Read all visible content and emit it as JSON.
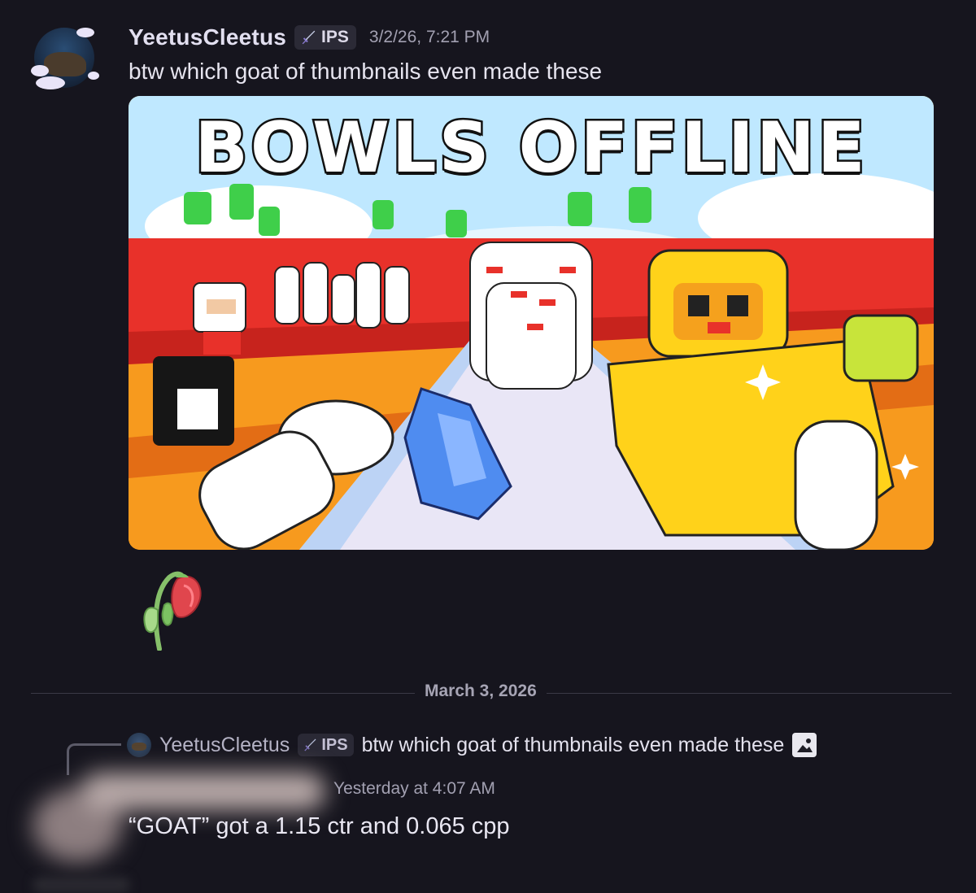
{
  "message1": {
    "author": "YeetusCleetus",
    "tag": "IPS",
    "tag_icon": "sword-icon",
    "timestamp": "3/2/26, 7:21 PM",
    "text": "btw which goat of thumbnails even made these",
    "attachment": {
      "type": "image",
      "overlay_text": "BOWLS OFFLINE"
    },
    "reaction": {
      "emoji": "wilted-flower-icon"
    }
  },
  "date_divider": {
    "label": "March 3, 2026"
  },
  "message2": {
    "reply_to": {
      "author": "YeetusCleetus",
      "tag": "IPS",
      "text": "btw which goat of thumbnails even made these",
      "attachment_icon": "image-icon"
    },
    "author_blurred": true,
    "timestamp": "Yesterday at 4:07 AM",
    "text": "“GOAT” got a 1.15 ctr and 0.065 cpp"
  },
  "colors": {
    "background": "#16151e",
    "username": "#e2dff0",
    "muted": "#a2a0b1",
    "tag_bg": "#2b2a36"
  }
}
